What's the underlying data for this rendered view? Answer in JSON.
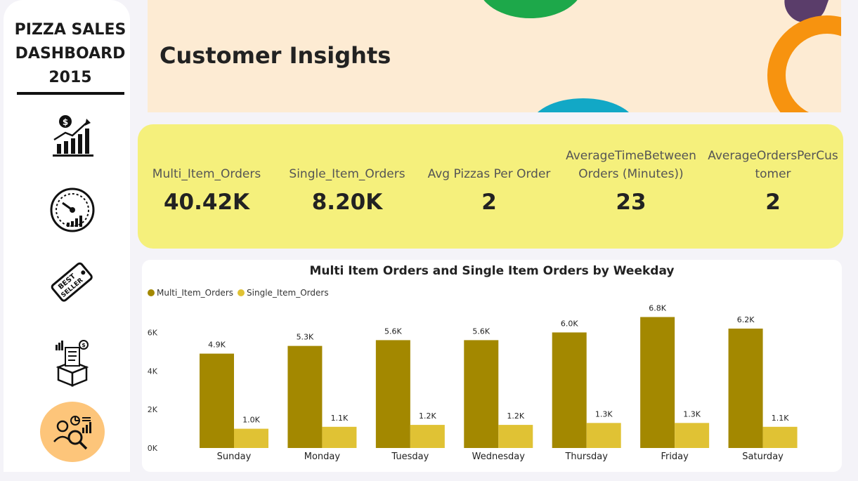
{
  "sidebar": {
    "brand_line1": "PIZZA SALES",
    "brand_line2": "DASHBOARD",
    "brand_line3": "2015",
    "nav": [
      {
        "icon": "sales-growth-icon"
      },
      {
        "icon": "performance-gauge-icon"
      },
      {
        "icon": "best-seller-tag-icon"
      },
      {
        "icon": "product-analysis-icon"
      },
      {
        "icon": "customer-insights-icon",
        "active": true
      }
    ],
    "active_color": "#fdc57a"
  },
  "header": {
    "title": "Customer Insights",
    "background": "#fdebd3"
  },
  "kpis": {
    "background": "#f5f07c",
    "items": [
      {
        "label_line1": "Multi_Item_Orders",
        "label_line2": "",
        "value": "40.42K"
      },
      {
        "label_line1": "Single_Item_Orders",
        "label_line2": "",
        "value": "8.20K"
      },
      {
        "label_line1": "Avg Pizzas Per Order",
        "label_line2": "",
        "value": "2"
      },
      {
        "label_line1": "AverageTimeBetween",
        "label_line2": "Orders (Minutes))",
        "value": "23"
      },
      {
        "label_line1": "AverageOrdersPerCus",
        "label_line2": "tomer",
        "value": "2"
      }
    ]
  },
  "chart_data": {
    "type": "bar",
    "title": "Multi Item Orders and Single Item Orders by Weekday",
    "categories": [
      "Sunday",
      "Monday",
      "Tuesday",
      "Wednesday",
      "Thursday",
      "Friday",
      "Saturday"
    ],
    "series": [
      {
        "name": "Multi_Item_Orders",
        "color": "#a38800",
        "values": [
          4900,
          5300,
          5600,
          5600,
          6000,
          6800,
          6200
        ],
        "labels": [
          "4.9K",
          "5.3K",
          "5.6K",
          "5.6K",
          "6.0K",
          "6.8K",
          "6.2K"
        ]
      },
      {
        "name": "Single_Item_Orders",
        "color": "#e0c234",
        "values": [
          1000,
          1100,
          1200,
          1200,
          1300,
          1300,
          1100
        ],
        "labels": [
          "1.0K",
          "1.1K",
          "1.2K",
          "1.2K",
          "1.3K",
          "1.3K",
          "1.1K"
        ]
      }
    ],
    "yticks": [
      "0K",
      "2K",
      "4K",
      "6K"
    ],
    "ylim": [
      0,
      7000
    ],
    "legend": "top-left",
    "grid": false
  }
}
